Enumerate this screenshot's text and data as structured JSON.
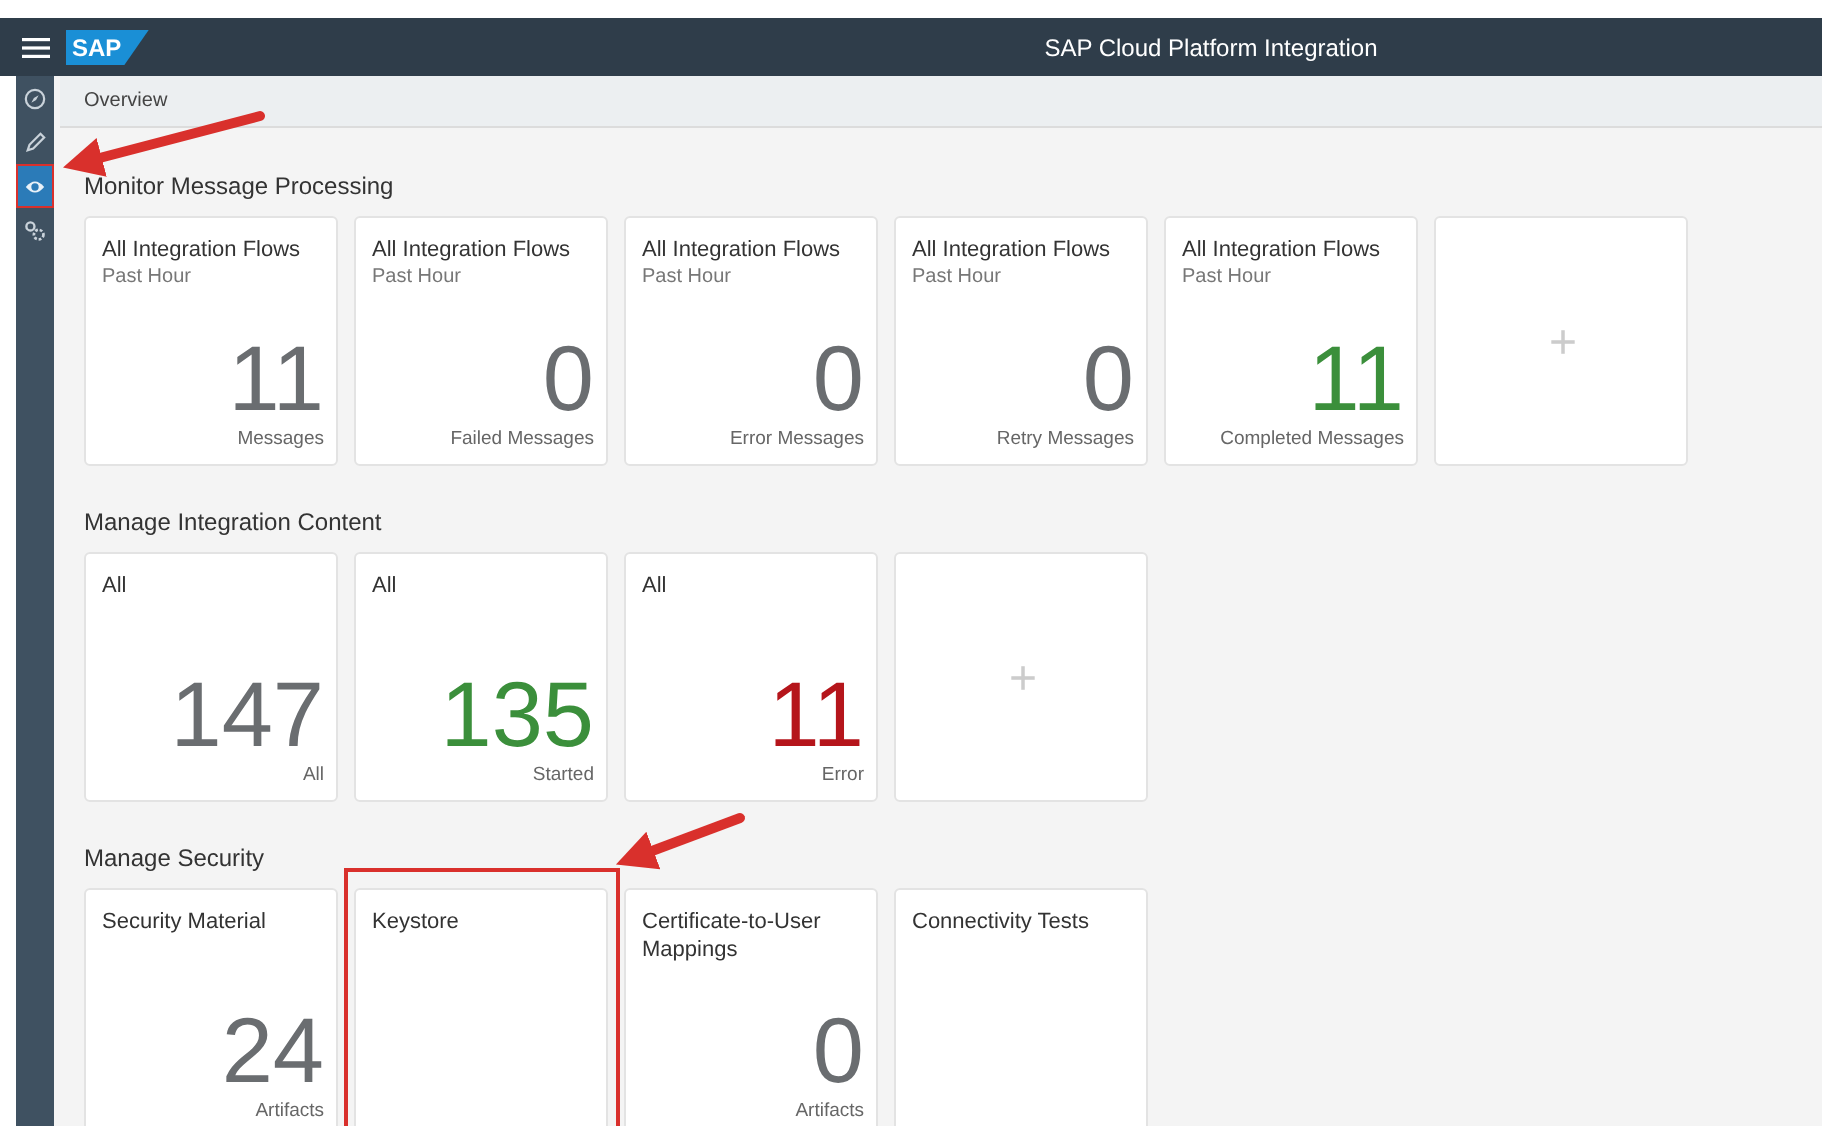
{
  "header": {
    "logo": "SAP",
    "title": "SAP Cloud Platform Integration"
  },
  "sidebar": {
    "items": [
      {
        "kind": "discover",
        "selected": false
      },
      {
        "kind": "design",
        "selected": false
      },
      {
        "kind": "monitor",
        "selected": true
      },
      {
        "kind": "settings",
        "selected": false
      }
    ]
  },
  "breadcrumb": "Overview",
  "sections": [
    {
      "title": "Monitor Message Processing",
      "tiles": [
        {
          "kind": "count",
          "title": "All Integration Flows",
          "subtitle": "Past Hour",
          "number": "11",
          "unit": "Messages",
          "color": "#6a6d70"
        },
        {
          "kind": "count",
          "title": "All Integration Flows",
          "subtitle": "Past Hour",
          "number": "0",
          "unit": "Failed Messages",
          "color": "#6a6d70"
        },
        {
          "kind": "count",
          "title": "All Integration Flows",
          "subtitle": "Past Hour",
          "number": "0",
          "unit": "Error Messages",
          "color": "#6a6d70"
        },
        {
          "kind": "count",
          "title": "All Integration Flows",
          "subtitle": "Past Hour",
          "number": "0",
          "unit": "Retry Messages",
          "color": "#6a6d70"
        },
        {
          "kind": "count",
          "title": "All Integration Flows",
          "subtitle": "Past Hour",
          "number": "11",
          "unit": "Completed Messages",
          "color": "#3b8f3b"
        },
        {
          "kind": "add",
          "symbol": "+"
        }
      ]
    },
    {
      "title": "Manage Integration Content",
      "tiles": [
        {
          "kind": "count",
          "title": "All",
          "number": "147",
          "unit": "All",
          "color": "#6a6d70"
        },
        {
          "kind": "count",
          "title": "All",
          "number": "135",
          "unit": "Started",
          "color": "#3b8f3b"
        },
        {
          "kind": "count",
          "title": "All",
          "number": "11",
          "unit": "Error",
          "color": "#b5151b"
        },
        {
          "kind": "add",
          "symbol": "+"
        }
      ]
    },
    {
      "title": "Manage Security",
      "tiles": [
        {
          "kind": "count",
          "title": "Security Material",
          "number": "24",
          "unit": "Artifacts",
          "color": "#6a6d70"
        },
        {
          "kind": "plain",
          "title": "Keystore",
          "highlighted": true
        },
        {
          "kind": "count",
          "title": "Certificate-to-User Mappings",
          "number": "0",
          "unit": "Artifacts",
          "color": "#6a6d70"
        },
        {
          "kind": "plain",
          "title": "Connectivity Tests"
        }
      ]
    }
  ]
}
